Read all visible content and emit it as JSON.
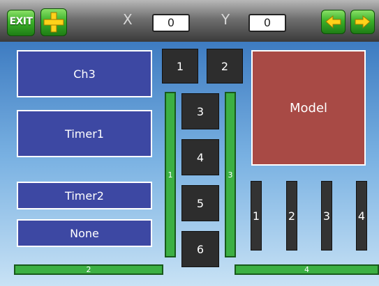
{
  "toolbar": {
    "exit_label": "EXIT",
    "x_label": "X",
    "x_value": "0",
    "y_label": "Y",
    "y_value": "0"
  },
  "sources": [
    {
      "label": "Ch3"
    },
    {
      "label": "Timer1"
    },
    {
      "label": "Timer2"
    },
    {
      "label": "None"
    }
  ],
  "numbered_boxes": [
    "1",
    "2",
    "3",
    "4",
    "5",
    "6"
  ],
  "green_vertical_bars": [
    "1",
    "3"
  ],
  "green_horizontal_bars": [
    "2",
    "4"
  ],
  "dark_vertical_bars": [
    "1",
    "2",
    "3",
    "4"
  ],
  "model_label": "Model",
  "colors": {
    "source_box": "#3d48a3",
    "model_box": "#a84a45",
    "green_bar": "#3cb043",
    "dark_box": "#2d2d2d"
  }
}
